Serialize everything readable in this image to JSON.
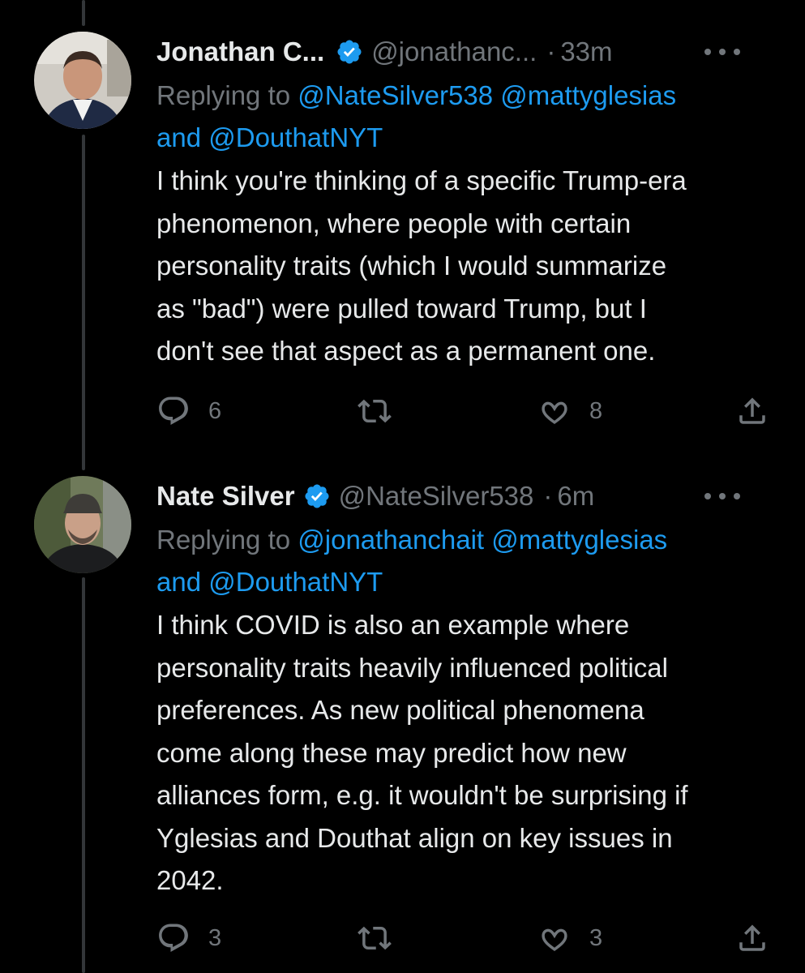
{
  "colors": {
    "background": "#000000",
    "text": "#e7e9ea",
    "muted": "#71767b",
    "accent": "#1d9bf0"
  },
  "tweets": [
    {
      "name": "Jonathan C...",
      "handle": "@jonathanc...",
      "separator": "·",
      "time": "33m",
      "verified_icon": "verified-badge-icon",
      "replying_prefix": "Replying to ",
      "mention_1": "@NateSilver538",
      "mention_2": "@mattyglesias",
      "and_text": "and ",
      "mention_3": "@DouthatNYT",
      "text": "I think you're thinking of a specific Trump-era\nphenomenon, where people with certain\npersonality traits (which I would summarize\nas \"bad\") were pulled toward Trump, but I\ndon't see that aspect as a permanent one.",
      "reply_count": "6",
      "retweet_count": "",
      "like_count": "8"
    },
    {
      "name": "Nate Silver",
      "handle": "@NateSilver538",
      "separator": "·",
      "time": "6m",
      "verified_icon": "verified-badge-icon",
      "replying_prefix": "Replying to ",
      "mention_1": "@jonathanchait",
      "mention_2": "@mattyglesias",
      "and_text": "and ",
      "mention_3": "@DouthatNYT",
      "text": "I think COVID is also an example where\npersonality traits heavily influenced political\npreferences. As new political phenomena\ncome along these may predict how new\nalliances form, e.g. it wouldn't be surprising if\nYglesias and Douthat align on key issues in\n2042.",
      "reply_count": "3",
      "retweet_count": "",
      "like_count": "3"
    }
  ]
}
